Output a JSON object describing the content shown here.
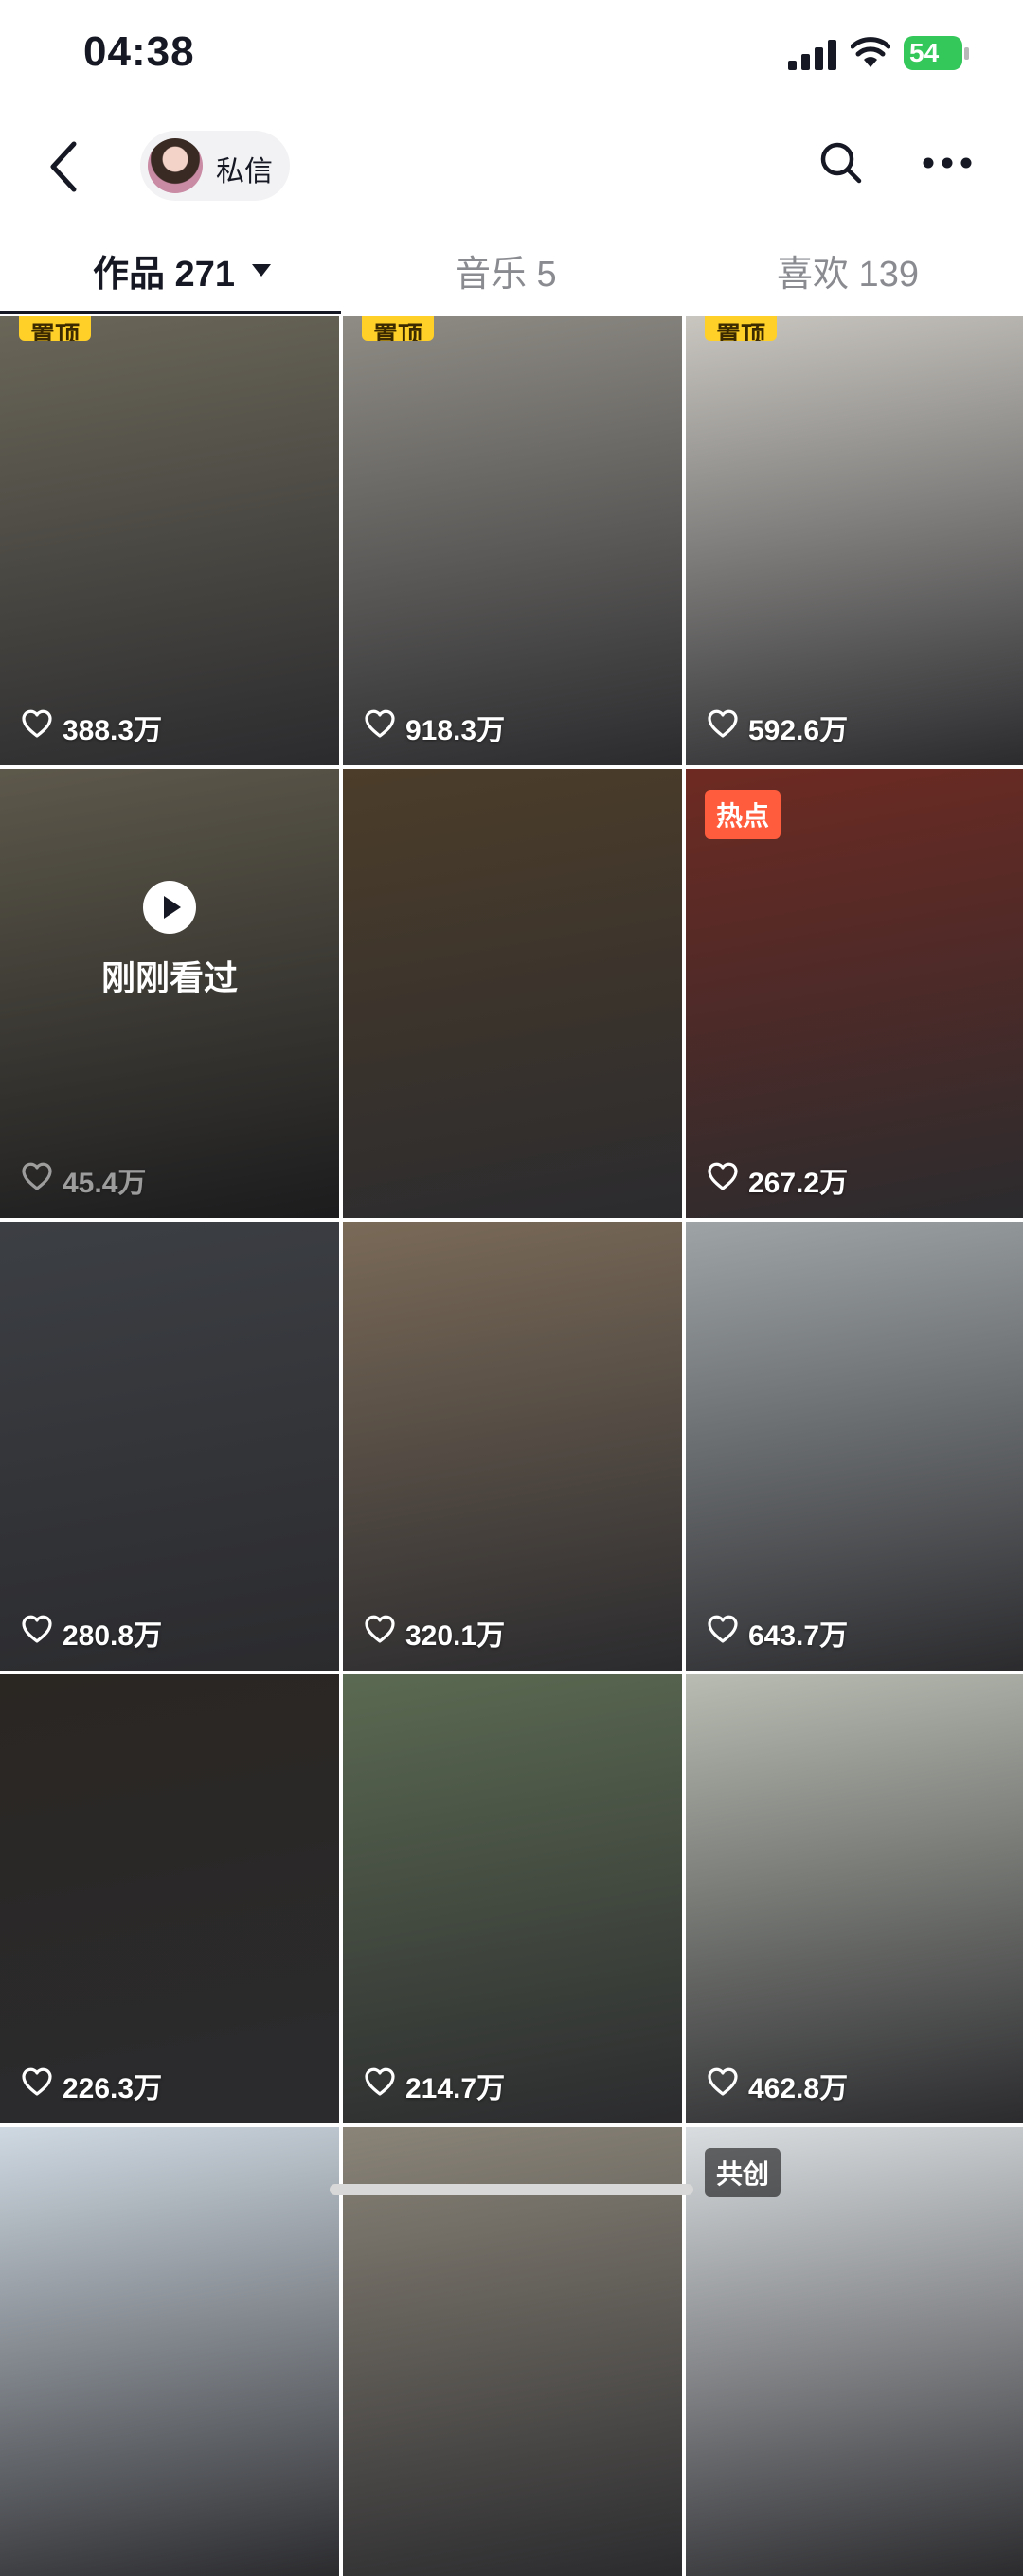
{
  "status_bar": {
    "time": "04:38",
    "battery": "54"
  },
  "header": {
    "dm_label": "私信"
  },
  "tabs": [
    {
      "label": "作品 271",
      "active": true
    },
    {
      "label": "音乐 5",
      "active": false
    },
    {
      "label": "喜欢 139",
      "active": false
    }
  ],
  "videos": [
    {
      "likes": "388.3万",
      "badge": "置顶",
      "bg": "#6a6658"
    },
    {
      "likes": "918.3万",
      "badge": "置顶",
      "bg": "#8f8c85"
    },
    {
      "likes": "592.6万",
      "badge": "置顶",
      "bg": "#c9c6c0"
    },
    {
      "likes": "45.4万",
      "watched": "刚刚看过",
      "bg": "#8f8873"
    },
    {
      "likes": "",
      "bg": "#4c3d2a"
    },
    {
      "likes": "267.2万",
      "badge": "热点",
      "bg": "#6e2a22"
    },
    {
      "likes": "280.8万",
      "bg": "#3c3f44"
    },
    {
      "likes": "320.1万",
      "bg": "#7a6a58"
    },
    {
      "likes": "643.7万",
      "bg": "#9ea4a6"
    },
    {
      "likes": "226.3万",
      "bg": "#2a2622"
    },
    {
      "likes": "214.7万",
      "bg": "#5b6a52"
    },
    {
      "likes": "462.8万",
      "bg": "#b8bcb2"
    },
    {
      "likes": "",
      "bg": "#cfd9e2"
    },
    {
      "likes": "",
      "bg": "#8a8478"
    },
    {
      "likes": "",
      "badge": "共创",
      "bg": "#d9dde0"
    }
  ]
}
